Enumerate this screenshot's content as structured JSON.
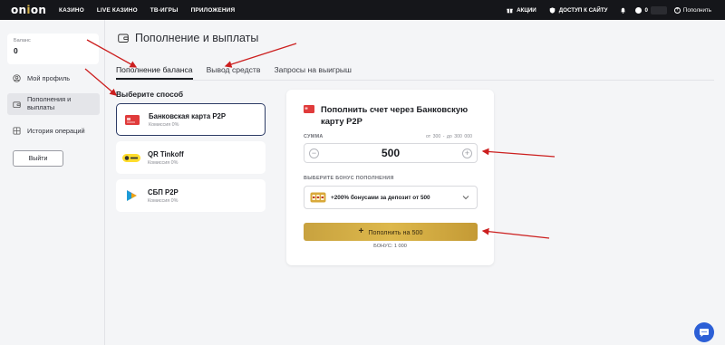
{
  "brand": {
    "logo_text_a": "on",
    "logo_text_o": "i",
    "logo_text_b": "on"
  },
  "topnav": {
    "left": [
      "КАЗИНО",
      "LIVE КАЗИНО",
      "ТВ-ИГРЫ",
      "ПРИЛОЖЕНИЯ"
    ],
    "promo": "АКЦИИ",
    "access": "ДОСТУП К САЙТУ",
    "balance": "0",
    "topup": "Пополнить"
  },
  "sidebar": {
    "balance_label": "Баланс",
    "balance_value": "0",
    "items": [
      {
        "label": "Мой профиль"
      },
      {
        "label": "Пополнения и выплаты"
      },
      {
        "label": "История операций"
      }
    ],
    "logout": "Выйти"
  },
  "page": {
    "title": "Пополнение и выплаты",
    "tabs": [
      "Пополнение баланса",
      "Вывод средств",
      "Запросы на выигрыш"
    ],
    "choose_method": "Выберите способ"
  },
  "methods": [
    {
      "name": "Банковская карта P2P",
      "fee": "Комиссия 0%",
      "icon": "bank-card-icon"
    },
    {
      "name": "QR Tinkoff",
      "fee": "Комиссия 0%",
      "icon": "tinkoff-icon"
    },
    {
      "name": "СБП P2P",
      "fee": "Комиссия 0%",
      "icon": "sbp-icon"
    }
  ],
  "deposit": {
    "title": "Пополнить счет через Банковскую карту P2P",
    "sum_label": "Сумма",
    "range": "от 300 - до 300 000",
    "amount": "500",
    "bonus_label": "Выберите бонус пополнения",
    "bonus_option": "+200% бонусами за депозит от 500",
    "button": "Пополнить на 500",
    "bonus_total": "БОНУС: 1 000"
  },
  "colors": {
    "topbar": "#15161a",
    "gold": "#d9b64c",
    "arrow": "#cc1f1f",
    "selected_border": "#2d3c66",
    "chat": "#2c5fd6"
  }
}
